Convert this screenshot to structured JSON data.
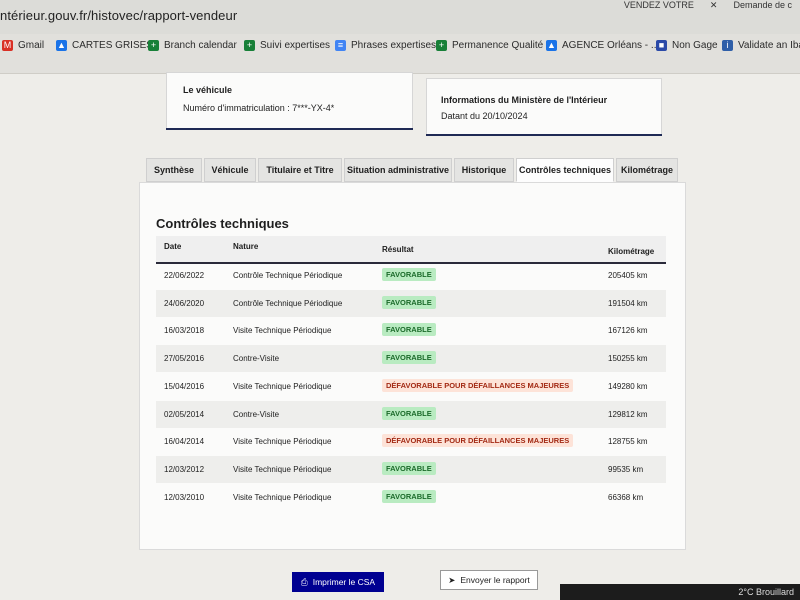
{
  "browser": {
    "url": "ntérieur.gouv.fr/histovec/rapport-vendeur",
    "tabs": [
      "VENDEZ VOTRE",
      "Demande de c"
    ],
    "bookmarks": [
      {
        "label": "Gmail",
        "icon": "gmail-icon",
        "color": "#d93025"
      },
      {
        "label": "CARTES GRISES",
        "icon": "drive-icon",
        "color": "#1a73e8"
      },
      {
        "label": "Branch calendar",
        "icon": "plus-icon",
        "color": "#188038"
      },
      {
        "label": "Suivi expertises",
        "icon": "plus-icon",
        "color": "#188038"
      },
      {
        "label": "Phrases expertises",
        "icon": "doc-icon",
        "color": "#4285f4"
      },
      {
        "label": "Permanence Qualité",
        "icon": "plus-icon",
        "color": "#188038"
      },
      {
        "label": "AGENCE Orléans - ...",
        "icon": "drive-icon",
        "color": "#1a73e8"
      },
      {
        "label": "Non Gage",
        "icon": "flag-icon",
        "color": "#2b4aa8"
      },
      {
        "label": "Validate an Iban",
        "icon": "iban-icon",
        "color": "#2f5fa8"
      }
    ]
  },
  "vehicle": {
    "title": "Le véhicule",
    "registration": "Numéro d'immatriculation : 7***-YX-4*"
  },
  "ministry": {
    "title": "Informations du Ministère de l'Intérieur",
    "date": "Datant du 20/10/2024"
  },
  "tabs": [
    "Synthèse",
    "Véhicule",
    "Titulaire et Titre",
    "Situation administrative",
    "Historique",
    "Contrôles techniques",
    "Kilométrage"
  ],
  "section_title": "Contrôles techniques",
  "columns": [
    "Date",
    "Nature",
    "Résultat",
    "Kilométrage"
  ],
  "rows": [
    {
      "date": "22/06/2022",
      "nature": "Contrôle Technique Périodique",
      "result": "FAVORABLE",
      "km": "205405 km"
    },
    {
      "date": "24/06/2020",
      "nature": "Contrôle Technique Périodique",
      "result": "FAVORABLE",
      "km": "191504 km"
    },
    {
      "date": "16/03/2018",
      "nature": "Visite Technique Périodique",
      "result": "FAVORABLE",
      "km": "167126 km"
    },
    {
      "date": "27/05/2016",
      "nature": "Contre-Visite",
      "result": "FAVORABLE",
      "km": "150255 km"
    },
    {
      "date": "15/04/2016",
      "nature": "Visite Technique Périodique",
      "result": "DÉFAVORABLE POUR DÉFAILLANCES MAJEURES",
      "km": "149280 km"
    },
    {
      "date": "02/05/2014",
      "nature": "Contre-Visite",
      "result": "FAVORABLE",
      "km": "129812 km"
    },
    {
      "date": "16/04/2014",
      "nature": "Visite Technique Périodique",
      "result": "DÉFAVORABLE POUR DÉFAILLANCES MAJEURES",
      "km": "128755 km"
    },
    {
      "date": "12/03/2012",
      "nature": "Visite Technique Périodique",
      "result": "FAVORABLE",
      "km": "99535 km"
    },
    {
      "date": "12/03/2010",
      "nature": "Visite Technique Périodique",
      "result": "FAVORABLE",
      "km": "66368 km"
    }
  ],
  "actions": {
    "print": "Imprimer le CSA",
    "send": "Envoyer le rapport"
  },
  "taskbar": {
    "weather": "2°C  Brouillard"
  },
  "colors": {
    "primary": "#000091",
    "good_bg": "#b9ebc1",
    "bad_bg": "#fde3d8"
  }
}
